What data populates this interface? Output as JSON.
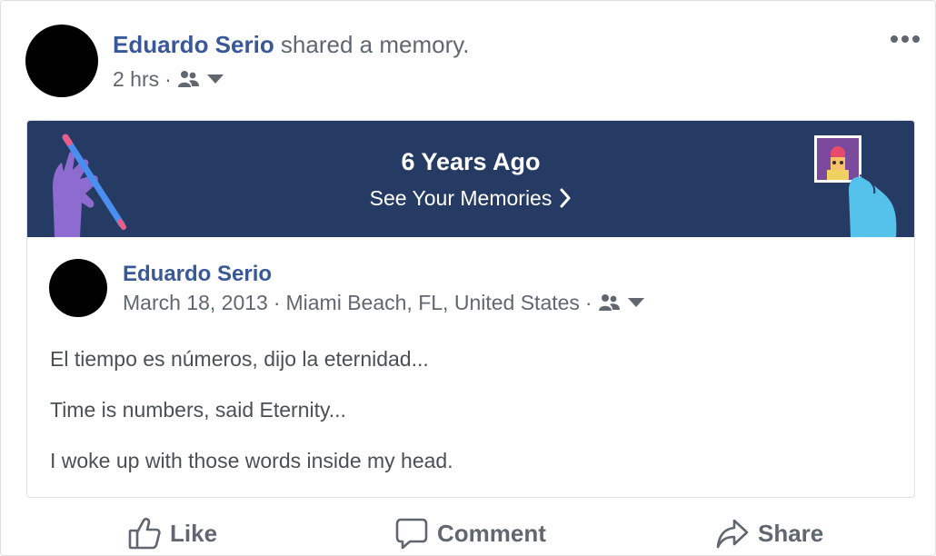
{
  "post": {
    "author": "Eduardo Serio",
    "action_text": " shared a memory.",
    "time": "2 hrs",
    "separator": "·",
    "audience_icon": "friends-icon",
    "more_icon": "more-options-icon"
  },
  "memory": {
    "banner_title": "6 Years Ago",
    "banner_link": "See Your Memories",
    "banner_bg": "#263b63",
    "original_post": {
      "author": "Eduardo Serio",
      "date": "March 18, 2013",
      "location": "Miami Beach, FL, United States",
      "separator": "·",
      "paragraphs": [
        "El tiempo es números, dijo la eternidad...",
        "Time is numbers, said Eternity...",
        "I woke up with those words inside my head."
      ]
    }
  },
  "actions": {
    "like": "Like",
    "comment": "Comment",
    "share": "Share"
  },
  "colors": {
    "link_blue": "#385898",
    "meta_gray": "#606770",
    "body_text": "#4b4f56"
  }
}
